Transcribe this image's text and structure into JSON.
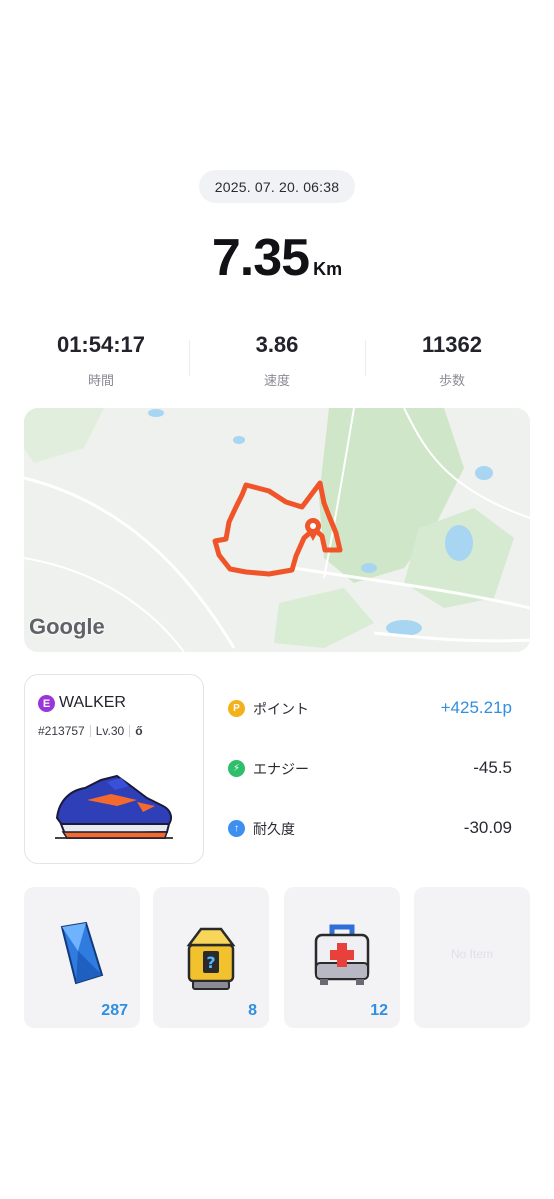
{
  "activity": {
    "datetime": "2025. 07. 20. 06:38",
    "distance": "7.35",
    "distance_unit": "Km"
  },
  "stats": [
    {
      "value": "01:54:17",
      "label": "時間"
    },
    {
      "value": "3.86",
      "label": "速度"
    },
    {
      "value": "11362",
      "label": "歩数"
    }
  ],
  "map": {
    "attribution": "Google",
    "route_color": "#f0552a",
    "marker_color": "#f0552a"
  },
  "walker": {
    "badge_letter": "E",
    "name": "WALKER",
    "id": "#213757",
    "level": "Lv.30",
    "gender_symbol": "ő",
    "badge_color": "#9b34d9"
  },
  "rewards": [
    {
      "icon": "point-coin-icon",
      "icon_text": "P",
      "label": "ポイント",
      "value": "+425.21p",
      "color": "#f2b21b",
      "value_color": "#2f8fe0"
    },
    {
      "icon": "energy-bolt-icon",
      "icon_text": "⚡",
      "label": "エナジー",
      "value": "-45.5",
      "color": "#2fbe6a",
      "value_color": "#2a2a33"
    },
    {
      "icon": "durability-arrow-icon",
      "icon_text": "↑",
      "label": "耐久度",
      "value": "-30.09",
      "color": "#3f8ff0",
      "value_color": "#2a2a33"
    }
  ],
  "items": [
    {
      "name": "blue-crystal-icon",
      "count": "287"
    },
    {
      "name": "mystery-box-icon",
      "count": "8"
    },
    {
      "name": "first-aid-kit-icon",
      "count": "12"
    },
    {
      "name": "empty-slot",
      "empty_text": "No Item"
    }
  ]
}
